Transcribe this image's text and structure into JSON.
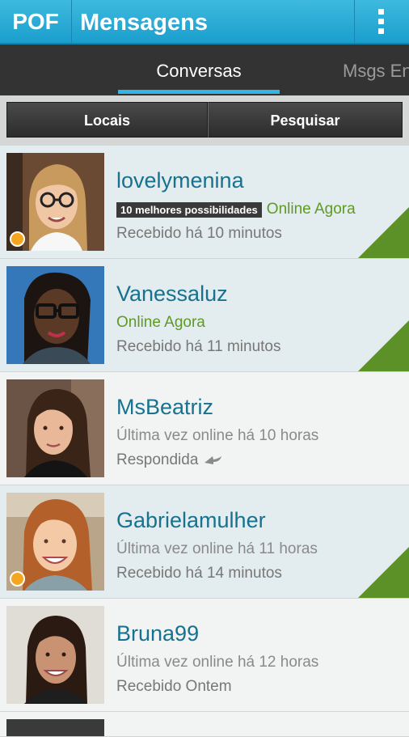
{
  "app": {
    "logo": "POF",
    "title": "Mensagens"
  },
  "tabs": [
    {
      "label": "Conversas",
      "active": true
    },
    {
      "label": "Msgs En",
      "active": false
    }
  ],
  "buttons": {
    "left": "Locais",
    "right": "Pesquisar"
  },
  "colors": {
    "accent": "#33b5e5",
    "online": "#5e9a24",
    "unread_corner": "#5b9127",
    "online_dot": "#f4a621"
  },
  "conversations": [
    {
      "name": "lovelymenina",
      "badge": "10 melhores possibilidades",
      "status": "Online Agora",
      "detail": "Recebido há 10 minutos",
      "unread": true,
      "online_dot": true
    },
    {
      "name": "Vanessaluz",
      "status": "Online Agora",
      "detail": "Recebido há 11 minutos",
      "unread": true,
      "online_dot": false
    },
    {
      "name": "MsBeatriz",
      "last_seen": "Última vez online há 10 horas",
      "detail": "Respondida",
      "unread": false,
      "replied_icon": "reply-arrow-icon"
    },
    {
      "name": "Gabrielamulher",
      "last_seen": "Última vez online há 11 horas",
      "detail": "Recebido há 14 minutos",
      "unread": true,
      "online_dot": true
    },
    {
      "name": "Bruna99",
      "last_seen": "Última vez online há 12 horas",
      "detail": "Recebido Ontem",
      "unread": false
    }
  ]
}
